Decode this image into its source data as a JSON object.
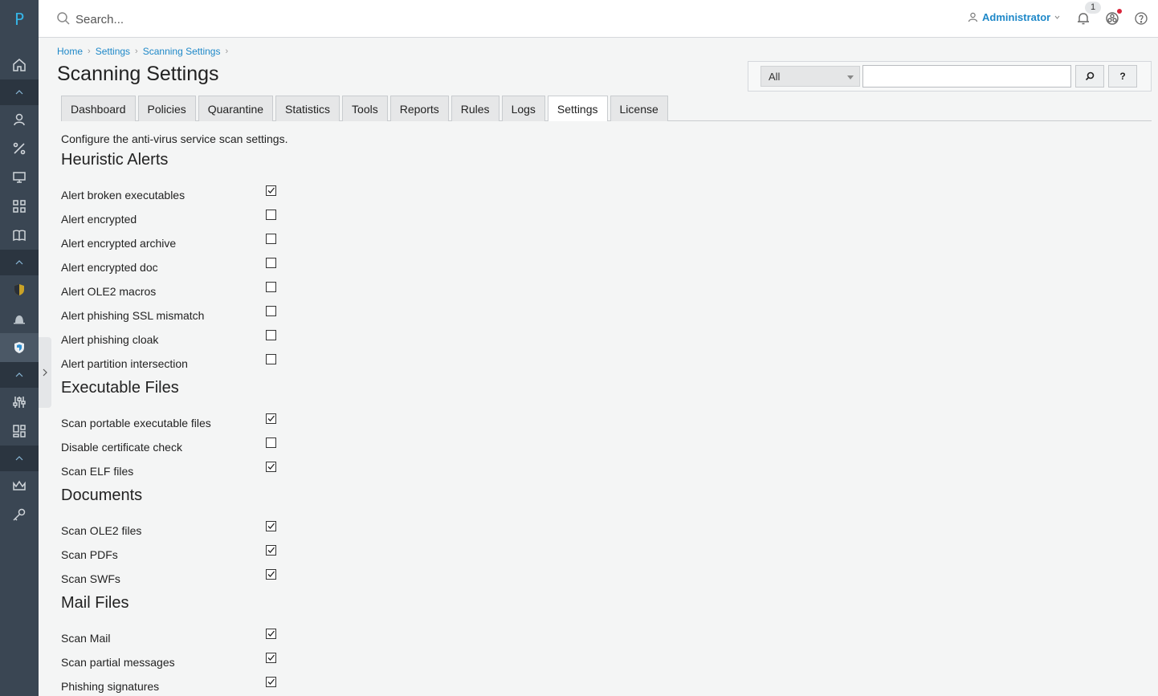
{
  "app": {
    "logo": "P"
  },
  "topbar": {
    "search_placeholder": "Search...",
    "user_name": "Administrator",
    "notification_count": "1"
  },
  "breadcrumb": [
    "Home",
    "Settings",
    "Scanning Settings"
  ],
  "page_title": "Scanning Settings",
  "search_box": {
    "filter_value": "All",
    "search_button": "⌕",
    "help_button": "?"
  },
  "tabs": [
    "Dashboard",
    "Policies",
    "Quarantine",
    "Statistics",
    "Tools",
    "Reports",
    "Rules",
    "Logs",
    "Settings",
    "License"
  ],
  "active_tab": "Settings",
  "description": "Configure the anti-virus service scan settings.",
  "sections": [
    {
      "title": "Heuristic Alerts",
      "items": [
        {
          "label": "Alert broken executables",
          "checked": true
        },
        {
          "label": "Alert encrypted",
          "checked": false
        },
        {
          "label": "Alert encrypted archive",
          "checked": false
        },
        {
          "label": "Alert encrypted doc",
          "checked": false
        },
        {
          "label": "Alert OLE2 macros",
          "checked": false
        },
        {
          "label": "Alert phishing SSL mismatch",
          "checked": false
        },
        {
          "label": "Alert phishing cloak",
          "checked": false
        },
        {
          "label": "Alert partition intersection",
          "checked": false
        }
      ]
    },
    {
      "title": "Executable Files",
      "items": [
        {
          "label": "Scan portable executable files",
          "checked": true
        },
        {
          "label": "Disable certificate check",
          "checked": false
        },
        {
          "label": "Scan ELF files",
          "checked": true
        }
      ]
    },
    {
      "title": "Documents",
      "items": [
        {
          "label": "Scan OLE2 files",
          "checked": true
        },
        {
          "label": "Scan PDFs",
          "checked": true
        },
        {
          "label": "Scan SWFs",
          "checked": true
        }
      ]
    },
    {
      "title": "Mail Files",
      "items": [
        {
          "label": "Scan Mail",
          "checked": true
        },
        {
          "label": "Scan partial messages",
          "checked": true
        },
        {
          "label": "Phishing signatures",
          "checked": true
        }
      ]
    }
  ],
  "colors": {
    "sidebar": "#3a4653",
    "accent": "#1e88c8",
    "logo": "#36b4e5"
  },
  "sidebar_icons": [
    "home-icon",
    "user-icon",
    "percent-icon",
    "monitor-icon",
    "grid-icon",
    "book-icon",
    "shield-icon",
    "alarm-icon",
    "antivirus-icon",
    "sliders-icon",
    "dashboard-icon",
    "crown-icon",
    "key-icon"
  ]
}
